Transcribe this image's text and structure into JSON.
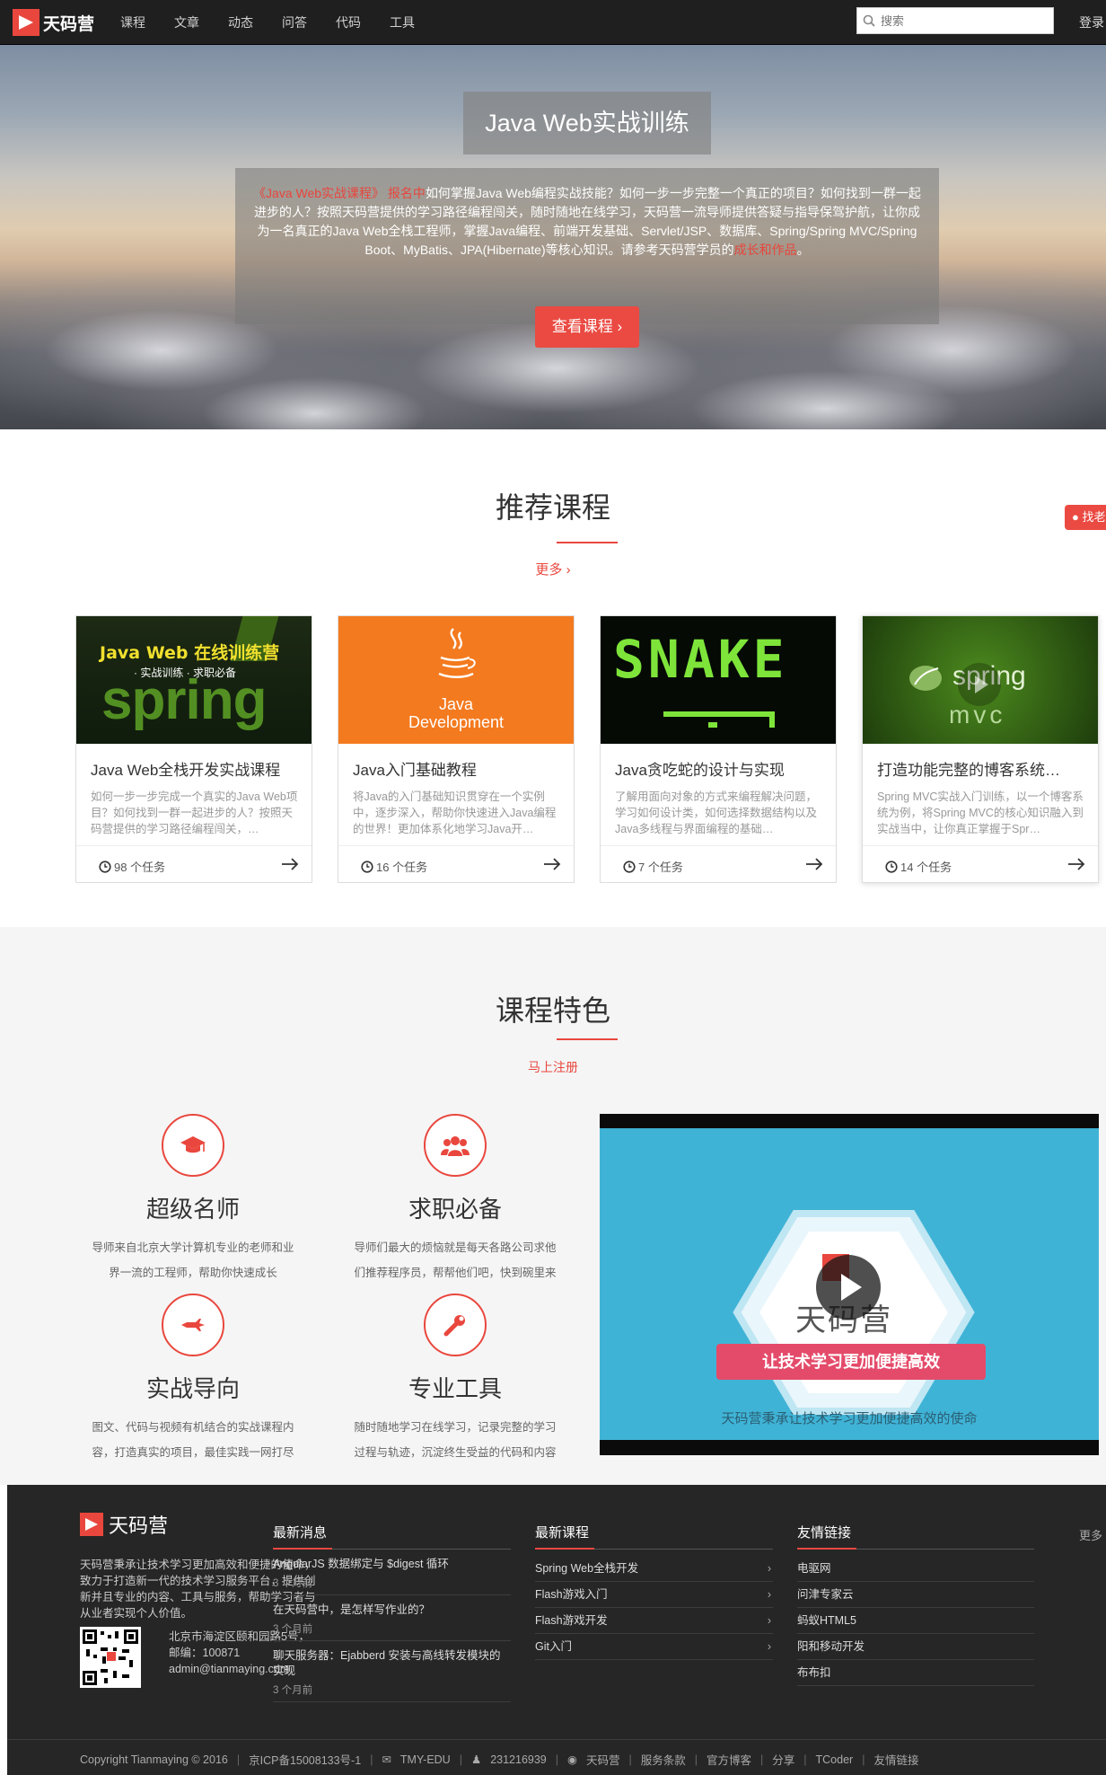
{
  "brand": {
    "name": "天码营",
    "accent": "#e9473e"
  },
  "nav": {
    "items": [
      "课程",
      "文章",
      "动态",
      "问答",
      "代码",
      "工具"
    ],
    "search_placeholder": "搜索",
    "login": "登录"
  },
  "hero": {
    "title": "Java Web实战训练",
    "desc_highlight": "《Java Web实战课程》 报名中",
    "desc_body": "如何掌握Java Web编程实战技能？如何一步一步完整一个真正的项目？如何找到一群一起进步的人？按照天码营提供的学习路径编程闯关，随时随地在线学习，天码营一流导师提供答疑与指导保驾护航，让你成为一名真正的Java Web全栈工程师，掌握Java编程、前端开发基础、Servlet/JSP、数据库、Spring/Spring MVC/Spring Boot、MyBatis、JPA(Hibernate)等核心知识。请参考天码营学员的",
    "desc_link": "成长和作品",
    "desc_end": "。",
    "button": "查看课程 ›"
  },
  "side_tab": "找老",
  "recommended": {
    "title": "推荐课程",
    "more": "更多 ›",
    "courses": [
      {
        "title": "Java Web全栈开发实战课程",
        "desc": "如何一步一步完成一个真实的Java Web项目？如何找到一群一起进步的人？按照天码营提供的学习路径编程闯关，…",
        "tasks": "98 个任务",
        "thumb_text_1": "Java Web 在线训练营",
        "thumb_text_2": "· 实战训练 · 求职必备",
        "thumb_text_3": "spring"
      },
      {
        "title": "Java入门基础教程",
        "desc": "将Java的入门基础知识贯穿在一个实例中，逐步深入，帮助你快速进入Java编程的世界！更加体系化地学习Java开…",
        "tasks": "16 个任务",
        "thumb_text_1": "Java",
        "thumb_text_2": "Development"
      },
      {
        "title": "Java贪吃蛇的设计与实现",
        "desc": "了解用面向对象的方式来编程解决问题，学习如何设计类，如何选择数据结构以及Java多线程与界面编程的基础…",
        "tasks": "7 个任务",
        "thumb_text_1": "SNAKE"
      },
      {
        "title": "打造功能完整的博客系统…",
        "desc": "Spring MVC实战入门训练，以一个博客系统为例，将Spring MVC的核心知识融入到实战当中，让你真正掌握于Spr…",
        "tasks": "14 个任务",
        "thumb_text_1": "spring",
        "thumb_text_2": "mvc"
      }
    ]
  },
  "features": {
    "title": "课程特色",
    "register": "马上注册",
    "items": [
      {
        "title": "超级名师",
        "desc": "导师来自北京大学计算机专业的老师和业界一流的工程师，帮助你快速成长",
        "icon": "graduation-cap-icon"
      },
      {
        "title": "求职必备",
        "desc": "导师们最大的烦恼就是每天各路公司求他们推荐程序员，帮帮他们吧，快到碗里来",
        "icon": "users-icon"
      },
      {
        "title": "实战导向",
        "desc": "图文、代码与视频有机结合的实战课程内容，打造真实的项目，最佳实践一网打尽",
        "icon": "fighter-jet-icon"
      },
      {
        "title": "专业工具",
        "desc": "随时随地学习在线学习，记录完整的学习过程与轨迹，沉淀终生受益的代码和内容",
        "icon": "wrench-icon"
      }
    ],
    "video": {
      "brand": "天码营",
      "ribbon": "让技术学习更加便捷高效",
      "caption": "天码营秉承让技术学习更加便捷高效的使命"
    }
  },
  "footer": {
    "brand": "天码营",
    "about": "天码营秉承让技术学习更加高效和便捷的使命，致力于打造新一代的技术学习服务平台，提供创新并且专业的内容、工具与服务，帮助学习者与从业者实现个人价值。",
    "address": [
      "北京市海淀区颐和园路5号，",
      "邮编：100871",
      "admin@tianmaying.com"
    ],
    "news": {
      "heading": "最新消息",
      "items": [
        {
          "title": "AngularJS 数据绑定与 $digest 循环",
          "date": "3 个月前"
        },
        {
          "title": "在天码营中，是怎样写作业的？",
          "date": "3 个月前"
        },
        {
          "title": "聊天服务器：Ejabberd 安装与高线转发模块的实现",
          "date": "3 个月前"
        }
      ]
    },
    "courses": {
      "heading": "最新课程",
      "items": [
        "Spring Web全栈开发",
        "Flash游戏入门",
        "Flash游戏开发",
        "Git入门"
      ]
    },
    "links": {
      "heading": "友情链接",
      "more": "更多",
      "items": [
        "电驱网",
        "问津专家云",
        "蚂蚁HTML5",
        "阳和移动开发",
        "布布扣"
      ]
    },
    "bottom": {
      "copyright": "Copyright Tianmaying © 2016",
      "icp": "京ICP备15008133号-1",
      "wechat": "TMY-EDU",
      "qq": "231216939",
      "weibo": "天码营",
      "terms": "服务条款",
      "blog": "官方博客",
      "share": "分享",
      "tcoder": "TCoder",
      "friends": "友情链接"
    }
  }
}
